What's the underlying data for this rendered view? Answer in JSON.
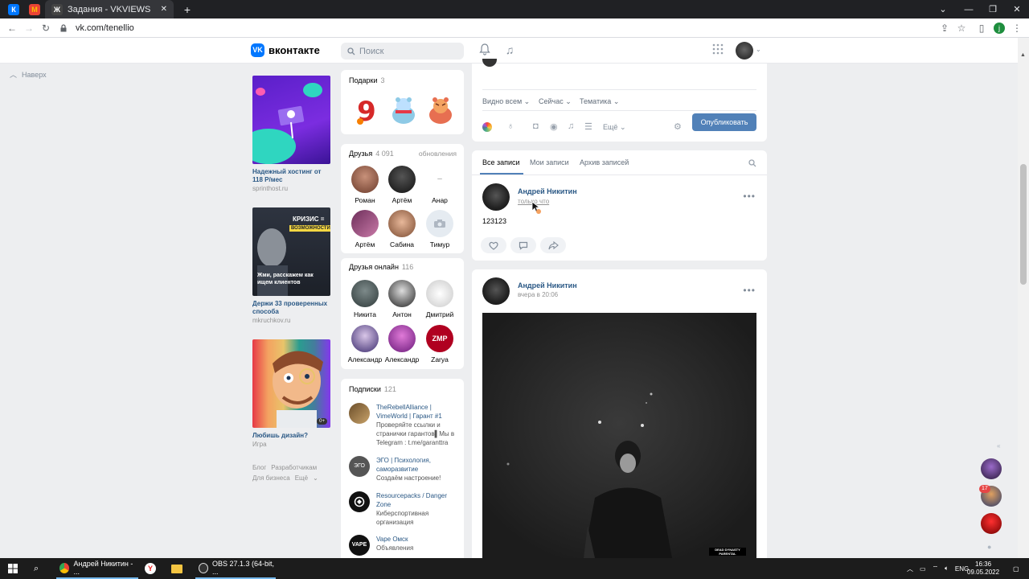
{
  "browser": {
    "tabs": [
      {
        "label": "",
        "icon": "vk-favicon"
      },
      {
        "label": "",
        "icon": "gmail-favicon"
      },
      {
        "label": "Задания - VKVIEWS",
        "icon": "vkviews-favicon"
      }
    ],
    "new_tab": "+",
    "url": "vk.com/tenellio",
    "profile_initial": "j"
  },
  "vk": {
    "logo_text": "вконтакте",
    "search_placeholder": "Поиск",
    "scroll_up_label": "Наверх"
  },
  "ads": [
    {
      "title": "Надежный хостинг от 118 Р/мес",
      "domain": "sprinthost.ru"
    },
    {
      "title": "Держи 33 проверенных способа",
      "domain": "mkruchkov.ru",
      "image_text_1": "КРИЗИС =",
      "image_text_2": "ВОЗМОЖНОСТИ",
      "image_text_3": "Жми, расскажем как ищем клиентов"
    },
    {
      "title": "Любишь дизайн?",
      "domain": "Игра",
      "image_badge": "0+"
    }
  ],
  "footer_links": [
    "Блог",
    "Разработчикам",
    "Для бизнеса",
    "Ещё"
  ],
  "gifts": {
    "title": "Подарки",
    "count": "3"
  },
  "friends": {
    "title": "Друзья",
    "count": "4 091",
    "updates": "обновления",
    "items": [
      "Роман",
      "Артём",
      "Анар",
      "Артём",
      "Сабина",
      "Тимур"
    ],
    "placeholder_dash": "–"
  },
  "friends_online": {
    "title": "Друзья онлайн",
    "count": "116",
    "items": [
      "Никита",
      "Антон",
      "Дмитрий",
      "Александр",
      "Александр",
      "Zarya"
    ]
  },
  "subscriptions": {
    "title": "Подписки",
    "count": "121",
    "items": [
      {
        "name": "TheRebellAlliance | VimeWorld | Гарант #1",
        "desc": "Проверяйте ссылки и странички гарантов▌Мы в Telegram : t.me/garanttra"
      },
      {
        "name": "ЭГО | Психология, саморазвитие",
        "desc": "Создаём настроение!"
      },
      {
        "name": "Resourcepacks / Danger Zone",
        "desc": "Киберспортивная организация"
      },
      {
        "name": "Vape Омск",
        "desc": "Объявления"
      }
    ]
  },
  "composer": {
    "visibility": "Видно всем",
    "time": "Сейчас",
    "topic": "Тематика",
    "more": "Ещё",
    "publish": "Опубликовать"
  },
  "feed_tabs": [
    "Все записи",
    "Мои записи",
    "Архив записей"
  ],
  "posts": [
    {
      "author": "Андрей Никитин",
      "time": "только что",
      "text": "123123"
    },
    {
      "author": "Андрей Никитин",
      "time": "вчера в 20:06",
      "image_label": "DEAD DYNASTY PARENTAL"
    }
  ],
  "right_float": {
    "badge": "17"
  },
  "taskbar": {
    "items": [
      "Андрей Никитин - ...",
      "",
      "",
      "OBS 27.1.3 (64-bit, ..."
    ],
    "lang": "ENG",
    "time": "16:36",
    "date": "09.05.2022"
  }
}
